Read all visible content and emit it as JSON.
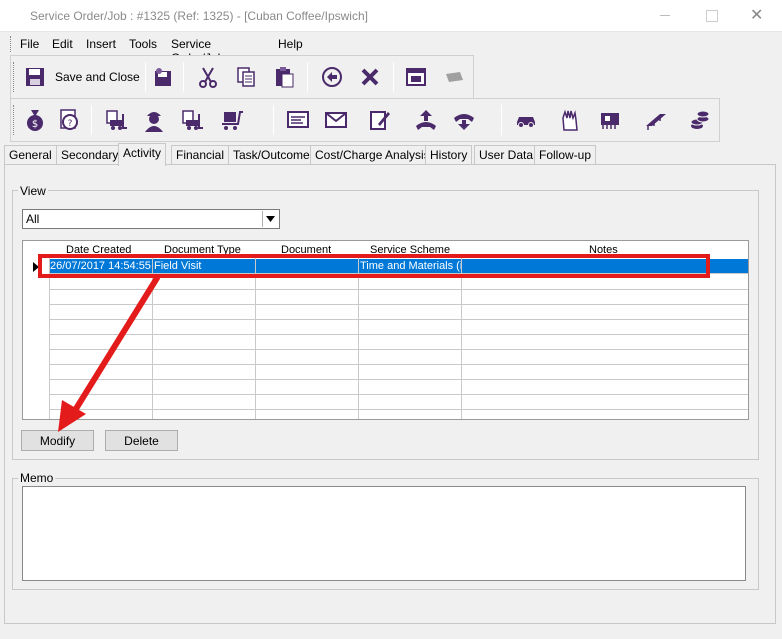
{
  "window": {
    "title": "Service Order/Job : #1325 (Ref: 1325) - [Cuban Coffee/Ipswich]",
    "close_glyph": "✕"
  },
  "menu": [
    "File",
    "Edit",
    "Insert",
    "Tools",
    "Service Order/Job",
    "Help"
  ],
  "toolbar1": {
    "save_close_label": "Save and Close",
    "icons": [
      "save-icon",
      "save-all-icon",
      "cut-icon",
      "copy-icon",
      "paste-icon",
      "undo-icon",
      "delete-icon",
      "window-icon",
      "disabled-icon"
    ]
  },
  "toolbar2": {
    "icons": [
      "money-bag-icon",
      "help-circle-icon",
      "forklift-icon",
      "technician-icon",
      "forklift-icon",
      "cart-icon",
      "document-icon",
      "email-icon",
      "edit-icon",
      "phone-out-icon",
      "phone-hangup-icon",
      "car-icon",
      "hand-icon",
      "circuit-board-icon",
      "conveyor-icon",
      "coins-icon"
    ]
  },
  "tabs": [
    "General",
    "Secondary",
    "Activity",
    "Financial",
    "Task/Outcome",
    "Cost/Charge Analysis",
    "History",
    "User Data",
    "Follow-up"
  ],
  "active_tab": "Activity",
  "view": {
    "group_label": "View",
    "filter_value": "All"
  },
  "grid": {
    "columns": [
      "Date Created",
      "Document Type",
      "Document",
      "Service Scheme",
      "Notes"
    ],
    "rows": [
      {
        "date": "26/07/2017 14:54:55",
        "doc_type": "Field Visit",
        "document": "",
        "scheme": "Time and Materials (i",
        "notes": ""
      }
    ]
  },
  "buttons": {
    "modify": "Modify",
    "delete": "Delete"
  },
  "memo": {
    "group_label": "Memo",
    "value": ""
  },
  "annotation": {
    "color": "#e41b1b"
  }
}
